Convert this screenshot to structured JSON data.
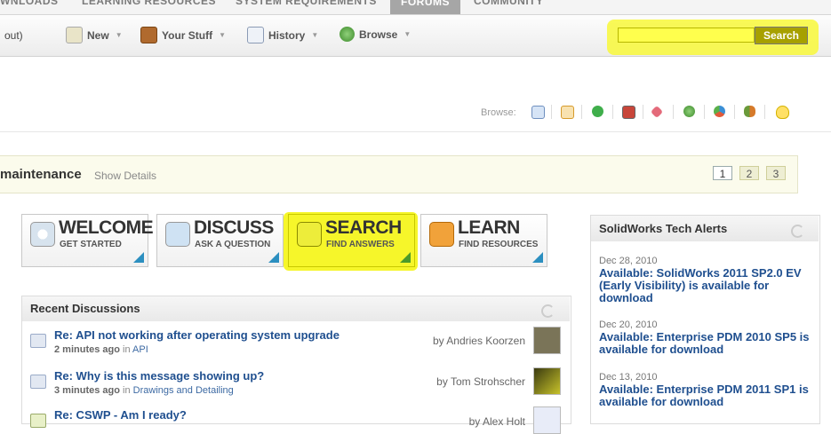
{
  "topnav": {
    "items": [
      {
        "label": "WNLOADS",
        "active": false
      },
      {
        "label": "LEARNING RESOURCES",
        "active": false
      },
      {
        "label": "SYSTEM REQUIREMENTS",
        "active": false
      },
      {
        "label": "FORUMS",
        "active": true
      },
      {
        "label": "COMMUNITY",
        "active": false
      }
    ]
  },
  "toolbar": {
    "logout_text": "out)",
    "new_label": "New",
    "your_stuff_label": "Your Stuff",
    "history_label": "History",
    "browse_label": "Browse",
    "search_value": "",
    "search_button": "Search"
  },
  "browse_bar": {
    "label": "Browse:",
    "icons": [
      "discussions-icon",
      "documents-icon",
      "blogs-icon",
      "videos-icon",
      "tags-icon",
      "places-icon",
      "groups-icon",
      "people-icon",
      "ideas-icon"
    ]
  },
  "maintenance": {
    "title": "maintenance",
    "link": "Show Details",
    "pages": [
      "1",
      "2",
      "3"
    ]
  },
  "tiles": [
    {
      "big": "WELCOME",
      "small": "GET STARTED",
      "icon": "power-icon"
    },
    {
      "big": "DISCUSS",
      "small": "ASK A QUESTION",
      "icon": "speech-bubble-icon"
    },
    {
      "big": "SEARCH",
      "small": "FIND ANSWERS",
      "icon": "magnifier-icon"
    },
    {
      "big": "LEARN",
      "small": "FIND RESOURCES",
      "icon": "book-icon"
    }
  ],
  "recent_discussions": {
    "title": "Recent Discussions",
    "rows": [
      {
        "title": "Re: API not working after operating system upgrade",
        "time": "2 minutes ago",
        "in_label": "in",
        "place": "API",
        "by": "by Andries Koorzen"
      },
      {
        "title": "Re: Why is this message showing up?",
        "time": "3 minutes ago",
        "in_label": "in",
        "place": "Drawings and Detailing",
        "by": "by Tom Strohscher"
      },
      {
        "title": "Re: CSWP - Am I ready?",
        "time": "",
        "in_label": "",
        "place": "",
        "by": "by Alex Holt"
      }
    ]
  },
  "tech_alerts": {
    "title": "SolidWorks Tech Alerts",
    "items": [
      {
        "date": "Dec 28, 2010",
        "text": "Available: SolidWorks 2011 SP2.0 EV (Early Visibility) is available for download"
      },
      {
        "date": "Dec 20, 2010",
        "text": "Available: Enterprise PDM 2010 SP5 is available for download"
      },
      {
        "date": "Dec 13, 2010",
        "text": "Available: Enterprise PDM 2011 SP1 is available for download"
      }
    ]
  },
  "colors": {
    "highlight": "#f6f62a",
    "link": "#1f4f8f",
    "tile_corner": "#2c8fc0"
  }
}
